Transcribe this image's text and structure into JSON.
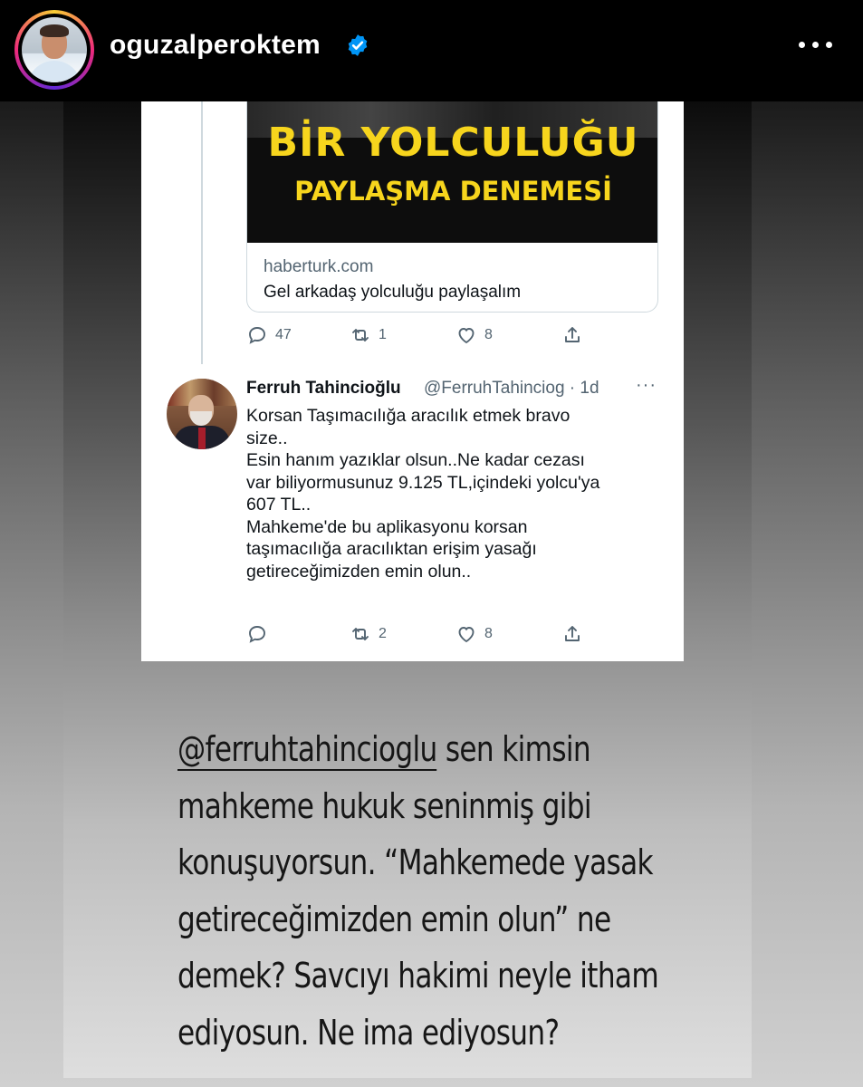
{
  "header": {
    "username": "oguzalperoktem",
    "verified_icon": "verified-badge-icon",
    "more_icon": "more-options-icon"
  },
  "tweet1": {
    "link_image": {
      "line1": "BİR YOLCULUĞU",
      "line2": "PAYLAŞMA DENEMESİ"
    },
    "link_domain": "haberturk.com",
    "link_title": "Gel arkadaş yolculuğu paylaşalım",
    "counts": {
      "replies": "47",
      "retweets": "1",
      "likes": "8"
    }
  },
  "tweet2": {
    "name": "Ferruh Tahincioğlu",
    "handle_time": "@FerruhTahinciog · 1d",
    "more": "···",
    "lines": [
      "Korsan Taşımacılığa aracılık etmek bravo",
      "size..",
      "Esin hanım yazıklar olsun..Ne kadar cezası",
      "var biliyormusunuz 9.125 TL,içindeki yolcu'ya",
      "607 TL..",
      "Mahkeme'de bu aplikasyonu korsan",
      "taşımacılığa aracılıktan erişim yasağı",
      "getireceğimizden emin olun.."
    ],
    "counts": {
      "retweets": "2",
      "likes": "8"
    }
  },
  "caption": {
    "mention": "@ferruhtahincioglu",
    "line1_rest": " sen kimsin",
    "line2": "mahkeme hukuk seninmiş gibi",
    "line3": "konuşuyorsun. “Mahkemede yasak",
    "line4": "getireceğimizden emin olun” ne",
    "line5": "demek? Savcıyı hakimi neyle itham",
    "line6": "ediyosun. Ne ima ediyosun?"
  },
  "colors": {
    "news_yellow": "#f7d51d",
    "twitter_gray": "#536471",
    "verified_blue": "#0095f6"
  }
}
